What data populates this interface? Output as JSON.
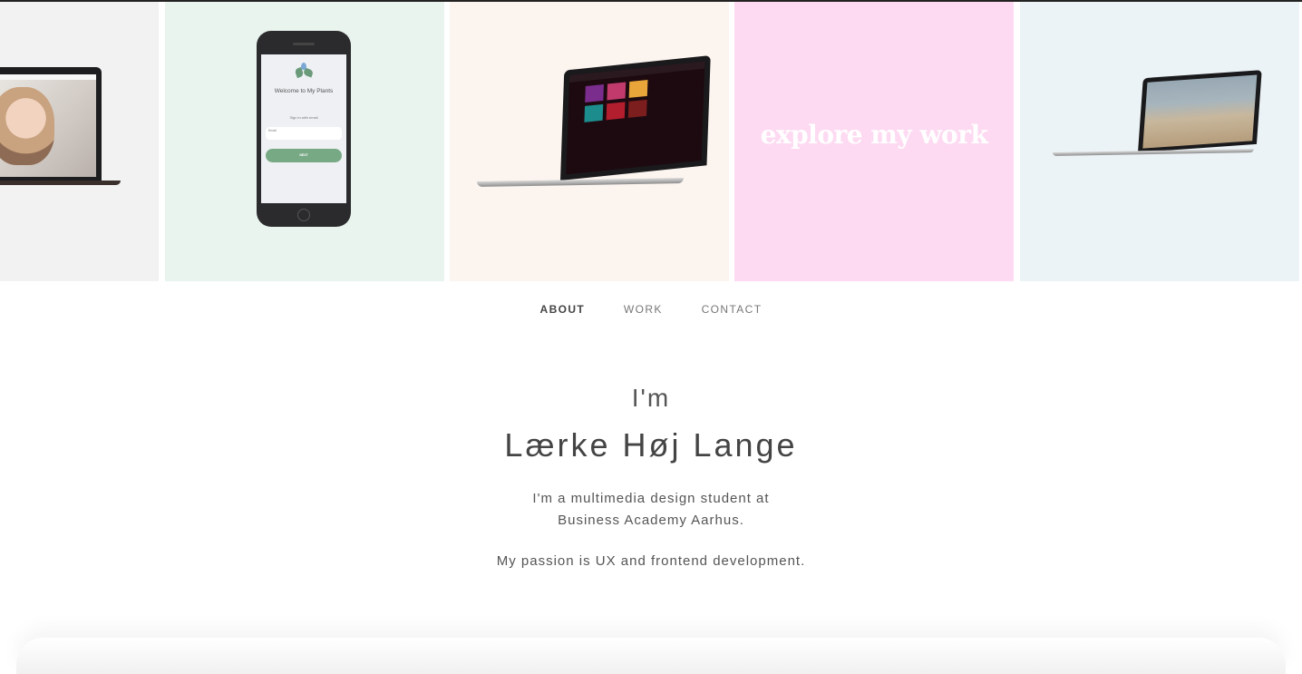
{
  "gallery": {
    "tiles": [
      {
        "bg": "#f2f2f2"
      },
      {
        "bg": "#e9f4ee",
        "phone_title": "Welcome to My Plants",
        "phone_sign_in": "Sign in with email",
        "phone_field_label": "Email",
        "phone_button": "NEXT"
      },
      {
        "bg": "#fcf4ef"
      },
      {
        "bg": "#fddaf1",
        "text": "explore my work"
      },
      {
        "bg": "#ecf3f6"
      }
    ]
  },
  "nav": {
    "about": "ABOUT",
    "work": "WORK",
    "contact": "CONTACT"
  },
  "intro": {
    "prefix": "I'm",
    "name": "Lærke Høj Lange",
    "line1": "I'm a multimedia design student at",
    "line2": "Business Academy Aarhus.",
    "passion": "My passion is UX and frontend development."
  }
}
